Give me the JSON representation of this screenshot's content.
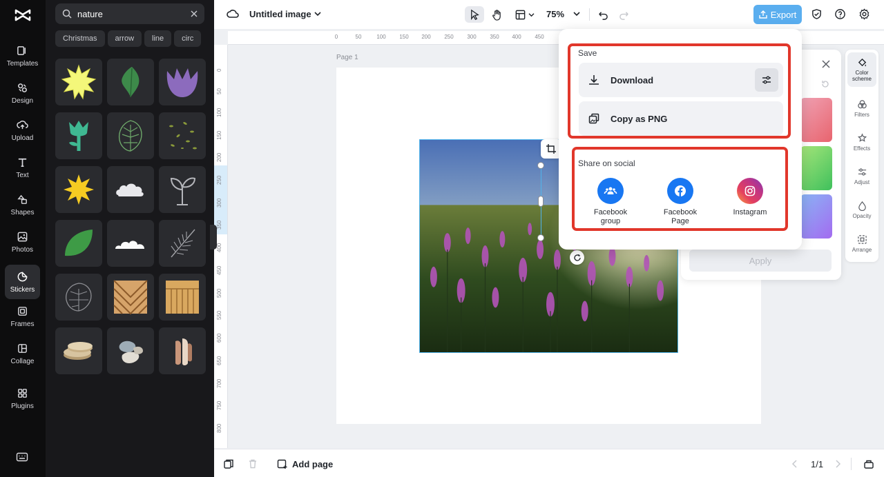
{
  "nav": {
    "items": [
      {
        "label": "Templates",
        "icon": "templates-icon"
      },
      {
        "label": "Design",
        "icon": "design-icon"
      },
      {
        "label": "Upload",
        "icon": "upload-icon"
      },
      {
        "label": "Text",
        "icon": "text-icon"
      },
      {
        "label": "Shapes",
        "icon": "shapes-icon"
      },
      {
        "label": "Photos",
        "icon": "photos-icon"
      },
      {
        "label": "Stickers",
        "icon": "stickers-icon",
        "active": true
      },
      {
        "label": "Frames",
        "icon": "frames-icon"
      },
      {
        "label": "Collage",
        "icon": "collage-icon"
      },
      {
        "label": "Plugins",
        "icon": "plugins-icon"
      }
    ]
  },
  "stickers": {
    "search_value": "nature",
    "tags": [
      "Christmas",
      "arrow",
      "line",
      "circ"
    ]
  },
  "topbar": {
    "title": "Untitled image",
    "zoom": "75%",
    "export_label": "Export"
  },
  "canvas": {
    "page_label": "Page 1",
    "ruler_top": [
      "0",
      "50",
      "100",
      "150",
      "200",
      "250",
      "300",
      "350",
      "400",
      "450"
    ],
    "ruler_left": [
      "0",
      "50",
      "100",
      "150",
      "200",
      "250",
      "300",
      "350",
      "400",
      "450",
      "500",
      "550",
      "600",
      "650",
      "700",
      "750",
      "800"
    ]
  },
  "export_popup": {
    "save_heading": "Save",
    "download_label": "Download",
    "copy_label": "Copy as PNG",
    "social_heading": "Share on social",
    "social": [
      {
        "label": "Facebook group",
        "color": "#1877f2",
        "icon": "facebook-group-icon"
      },
      {
        "label": "Facebook Page",
        "color": "#1877f2",
        "icon": "facebook-icon"
      },
      {
        "label": "Instagram",
        "color": "#d6249f",
        "icon": "instagram-icon"
      }
    ]
  },
  "color_panel": {
    "apply_label": "Apply"
  },
  "tools": [
    {
      "label": "Color scheme",
      "icon": "color-scheme-icon",
      "active": true
    },
    {
      "label": "Filters",
      "icon": "filters-icon"
    },
    {
      "label": "Effects",
      "icon": "effects-icon"
    },
    {
      "label": "Adjust",
      "icon": "adjust-icon"
    },
    {
      "label": "Opacity",
      "icon": "opacity-icon"
    },
    {
      "label": "Arrange",
      "icon": "arrange-icon"
    }
  ],
  "bottombar": {
    "add_page_label": "Add page",
    "page_counter": "1/1"
  },
  "colors": {
    "accent": "#5aaeef",
    "highlight": "#e1372b",
    "facebook": "#1877f2"
  }
}
